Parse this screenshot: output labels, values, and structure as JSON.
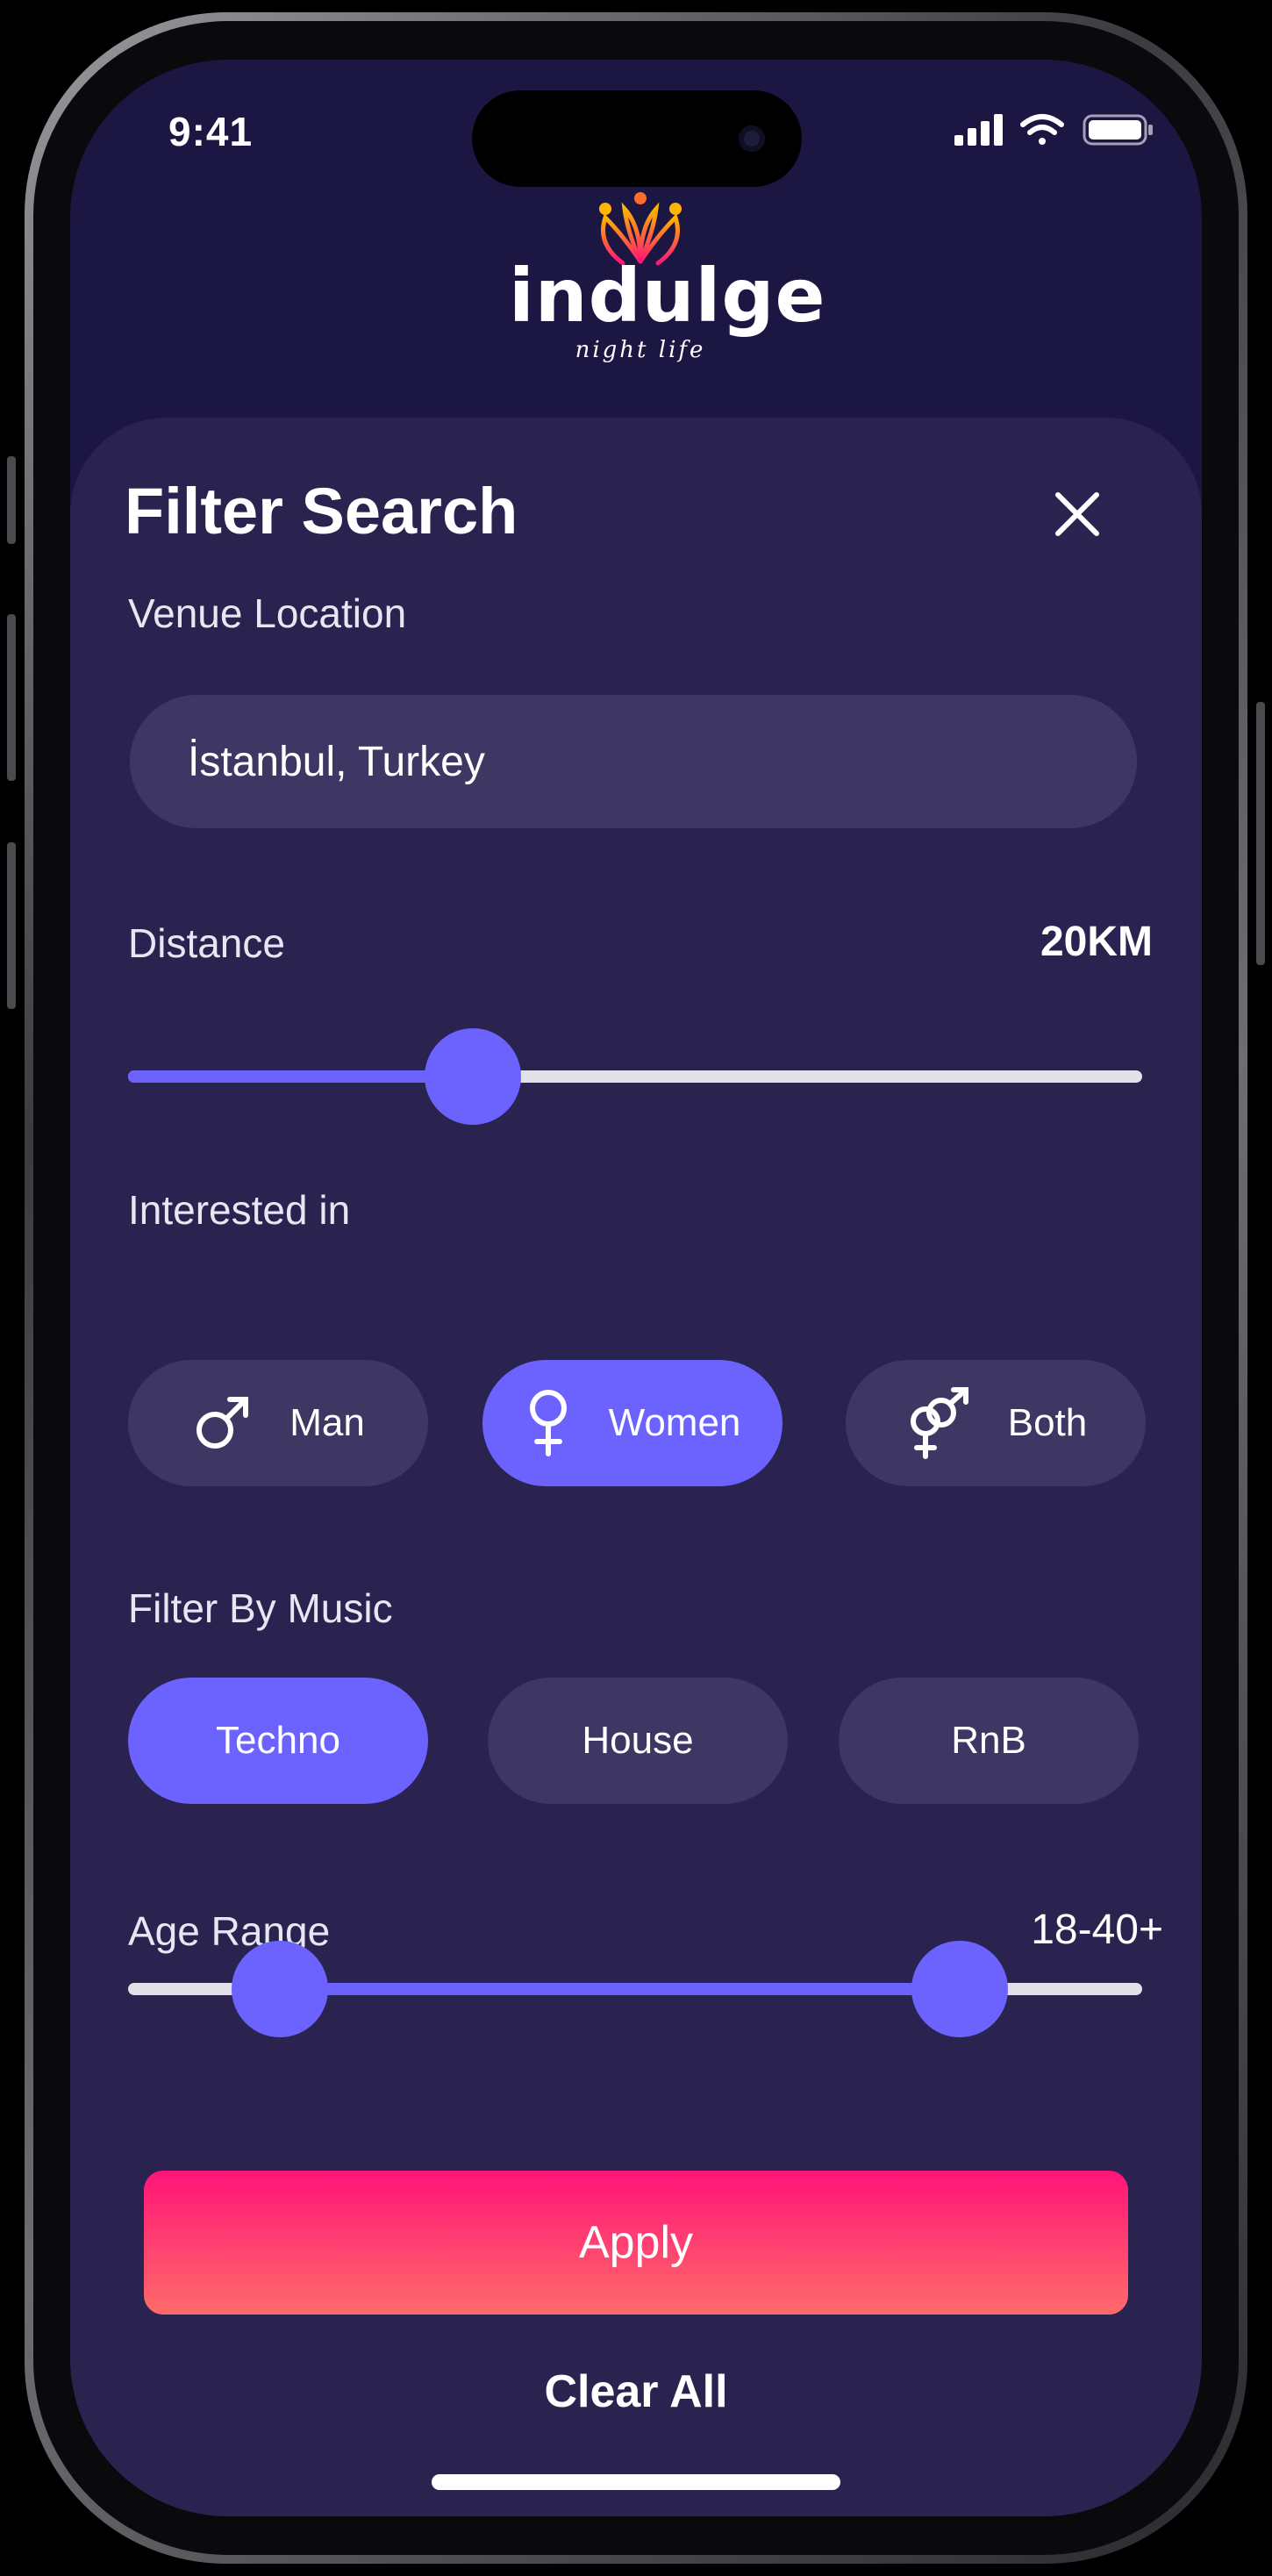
{
  "status": {
    "time": "9:41"
  },
  "brand": {
    "name": "indulge",
    "tagline": "night life"
  },
  "sheet": {
    "title": "Filter Search",
    "venue": {
      "label": "Venue Location",
      "value": "İstanbul, Turkey"
    },
    "distance": {
      "label": "Distance",
      "value_text": "20KM",
      "fraction": 0.34
    },
    "interest": {
      "label": "Interested in",
      "options": [
        {
          "label": "Man",
          "icon": "male-icon",
          "active": false
        },
        {
          "label": "Women",
          "icon": "female-icon",
          "active": true
        },
        {
          "label": "Both",
          "icon": "both-genders-icon",
          "active": false
        }
      ]
    },
    "music": {
      "label": "Filter By Music",
      "options": [
        {
          "label": "Techno",
          "active": true
        },
        {
          "label": "House",
          "active": false
        },
        {
          "label": "RnB",
          "active": false
        }
      ]
    },
    "age": {
      "label": "Age Range",
      "value_text": "18-40+",
      "low_fraction": 0.15,
      "high_fraction": 0.82
    },
    "apply_label": "Apply",
    "clear_label": "Clear All"
  },
  "colors": {
    "accent": "#6c63ff",
    "sheet": "#2a2350",
    "background": "#1c1642",
    "apply_start": "#ff1478",
    "apply_end": "#ff6b6a"
  }
}
